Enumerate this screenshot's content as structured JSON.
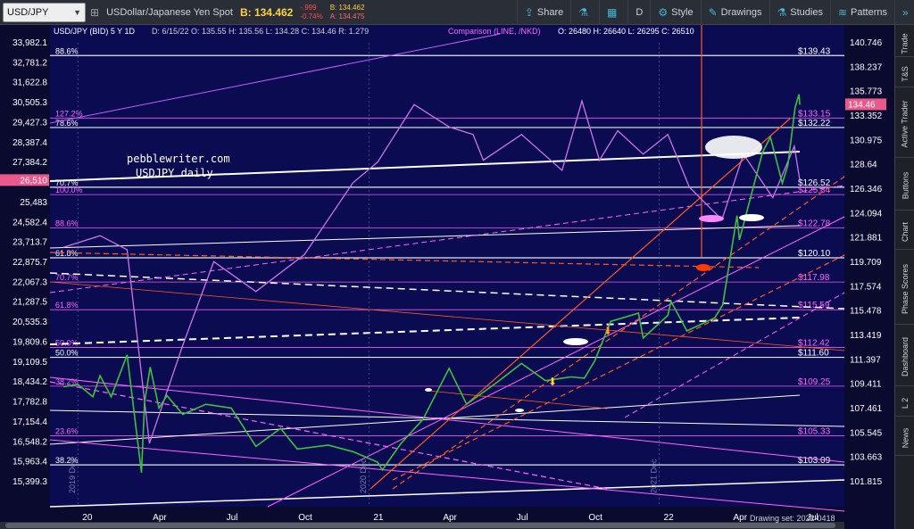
{
  "toolbar": {
    "symbol": "USD/JPY",
    "description": "USDollar/Japanese Yen Spot",
    "bid_label": "B: 134.462",
    "change": "-.999",
    "change_pct": "-0.74%",
    "bid_small": "B: 134.462",
    "ask_small": "A: 134.475",
    "buttons": [
      {
        "label": "Share",
        "icon": "share-icon"
      },
      {
        "label": "",
        "icon": "flask-icon"
      },
      {
        "label": "",
        "icon": "calendar-icon"
      },
      {
        "label": "D",
        "icon": ""
      },
      {
        "label": "Style",
        "icon": "gear-icon"
      },
      {
        "label": "Drawings",
        "icon": "pencil-icon"
      },
      {
        "label": "Studies",
        "icon": "flask-icon"
      },
      {
        "label": "Patterns",
        "icon": "patterns-icon"
      }
    ]
  },
  "side_tabs": [
    "Trade",
    "T&S",
    "Active Trader",
    "Buttons",
    "Chart",
    "Phase Scores",
    "Dashboard",
    "L 2",
    "News"
  ],
  "chart_data": {
    "type": "line",
    "header": {
      "title": "USD/JPY (BID) 5 Y 1D",
      "fields": [
        "D: 6/15/22",
        "O: 135.55",
        "H: 135.56",
        "L: 134.28",
        "C: 134.46",
        "R: 1.279"
      ],
      "comparison": "Comparison (LINE, /NKD)",
      "comparison_fields": [
        "O: 26480",
        "H: 26640",
        "L: 26295",
        "C: 26510"
      ]
    },
    "annotation": [
      "pebblewriter.com",
      "USDJPY daily"
    ],
    "x_ticks": [
      "20",
      "Apr",
      "Jul",
      "Oct",
      "21",
      "Apr",
      "Jul",
      "Oct",
      "22",
      "Apr",
      "Jul"
    ],
    "x_tick_years": [
      "2019 Dec",
      "2020 Dec",
      "2021 Dec"
    ],
    "right_axis": {
      "ticks": [
        140.746,
        138.237,
        135.773,
        133.352,
        130.975,
        128.64,
        126.346,
        124.094,
        121.881,
        119.709,
        117.574,
        115.478,
        113.419,
        111.397,
        109.411,
        107.461,
        105.545,
        103.663,
        101.815
      ],
      "labels": [
        "140.746",
        "138.237",
        "135.773",
        "133.352",
        "130.975",
        "128.64",
        "126.346",
        "124.094",
        "121.881",
        "119.709",
        "117.574",
        "115.478",
        "113.419",
        "111.397",
        "109.411",
        "107.461",
        "105.545",
        "103.663",
        "101.815"
      ],
      "current": "134.46"
    },
    "left_axis": {
      "ticks": [
        33982.1,
        32781.2,
        31622.8,
        30505.3,
        29427.3,
        28387.4,
        27384.2,
        25483,
        24582.4,
        23713.7,
        22875.7,
        22067.3,
        21287.5,
        20535.3,
        19809.6,
        19109.5,
        18434.2,
        17782.8,
        17154.4,
        16548.2,
        15963.4,
        15399.3
      ],
      "labels": [
        "33,982.1",
        "32,781.2",
        "31,622.8",
        "30,505.3",
        "29,427.3",
        "28,387.4",
        "27,384.2",
        "25,483",
        "24,582.4",
        "23,713.7",
        "22,875.7",
        "22,067.3",
        "21,287.5",
        "20,535.3",
        "19,809.6",
        "19,109.5",
        "18,434.2",
        "17,782.8",
        "17,154.4",
        "16,548.2",
        "15,963.4",
        "15,399.3"
      ],
      "current": "26,510"
    },
    "levels": [
      {
        "value": 139.43,
        "label": "$139.43",
        "color": "#ffffff",
        "pct": "88.6%",
        "pct_color": "#ffffff"
      },
      {
        "value": 133.15,
        "label": "$133.15",
        "color": "#ff66ff",
        "pct": "127.2%",
        "pct_color": "#ff66ff"
      },
      {
        "value": 132.22,
        "label": "$132.22",
        "color": "#ffffff",
        "pct": "78.6%",
        "pct_color": "#ffffff"
      },
      {
        "value": 126.52,
        "label": "$126.52",
        "color": "#ffffff",
        "pct": "70.7%",
        "pct_color": "#ffffff"
      },
      {
        "value": 125.84,
        "label": "$125.84",
        "color": "#ff66ff",
        "pct": "100.0%",
        "pct_color": "#ff66ff"
      },
      {
        "value": 122.78,
        "label": "$122.78",
        "color": "#ff66ff",
        "pct": "88.6%",
        "pct_color": "#ff66ff"
      },
      {
        "value": 120.1,
        "label": "$120.10",
        "color": "#ffffff",
        "pct": "61.8%",
        "pct_color": "#ffffff"
      },
      {
        "value": 117.98,
        "label": "$117.98",
        "color": "#ff66ff",
        "pct": "70.7%",
        "pct_color": "#ff66ff"
      },
      {
        "value": 115.59,
        "label": "$115.59",
        "color": "#ff66ff",
        "pct": "61.8%",
        "pct_color": "#ff66ff"
      },
      {
        "value": 112.42,
        "label": "$112.42",
        "color": "#ff66ff",
        "pct": "50.0%",
        "pct_color": "#ff66ff"
      },
      {
        "value": 111.6,
        "label": "$111.60",
        "color": "#ffffff",
        "pct": "50.0%",
        "pct_color": "#ffffff"
      },
      {
        "value": 109.25,
        "label": "$109.25",
        "color": "#ff66ff",
        "pct": "38.2%",
        "pct_color": "#ff66ff"
      },
      {
        "value": 105.33,
        "label": "$105.33",
        "color": "#ff66ff",
        "pct": "23.6%",
        "pct_color": "#ff66ff"
      },
      {
        "value": 103.09,
        "label": "$103.09",
        "color": "#ffffff",
        "pct": "38.2%",
        "pct_color": "#ffffff"
      }
    ],
    "price_series": [
      [
        "2019-12-02",
        109.2
      ],
      [
        "2019-12-20",
        109.4
      ],
      [
        "2020-01-08",
        108.4
      ],
      [
        "2020-01-17",
        110.1
      ],
      [
        "2020-01-31",
        108.4
      ],
      [
        "2020-02-20",
        111.8
      ],
      [
        "2020-03-09",
        102.5
      ],
      [
        "2020-03-13",
        108.0
      ],
      [
        "2020-03-20",
        110.8
      ],
      [
        "2020-03-31",
        107.5
      ],
      [
        "2020-04-10",
        108.5
      ],
      [
        "2020-04-30",
        107.0
      ],
      [
        "2020-05-29",
        107.8
      ],
      [
        "2020-06-30",
        107.5
      ],
      [
        "2020-07-31",
        104.5
      ],
      [
        "2020-08-31",
        105.9
      ],
      [
        "2020-09-21",
        104.3
      ],
      [
        "2020-10-30",
        104.6
      ],
      [
        "2020-11-30",
        104.1
      ],
      [
        "2020-12-31",
        103.3
      ],
      [
        "2021-01-06",
        102.7
      ],
      [
        "2021-01-29",
        104.7
      ],
      [
        "2021-02-26",
        106.6
      ],
      [
        "2021-03-31",
        110.7
      ],
      [
        "2021-04-22",
        107.8
      ],
      [
        "2021-05-31",
        109.6
      ],
      [
        "2021-06-30",
        111.1
      ],
      [
        "2021-07-30",
        109.7
      ],
      [
        "2021-08-31",
        110.0
      ],
      [
        "2021-09-17",
        109.9
      ],
      [
        "2021-09-30",
        111.3
      ],
      [
        "2021-10-20",
        114.6
      ],
      [
        "2021-11-24",
        115.3
      ],
      [
        "2021-11-30",
        113.2
      ],
      [
        "2021-12-31",
        115.1
      ],
      [
        "2022-01-04",
        116.3
      ],
      [
        "2022-01-24",
        113.8
      ],
      [
        "2022-02-28",
        114.9
      ],
      [
        "2022-03-10",
        116.0
      ],
      [
        "2022-03-28",
        123.9
      ],
      [
        "2022-03-31",
        121.7
      ],
      [
        "2022-04-29",
        129.8
      ],
      [
        "2022-05-09",
        131.3
      ],
      [
        "2022-05-24",
        126.9
      ],
      [
        "2022-05-31",
        128.6
      ],
      [
        "2022-06-09",
        134.2
      ],
      [
        "2022-06-14",
        135.5
      ],
      [
        "2022-06-15",
        134.46
      ]
    ],
    "comparison_series": [
      [
        "2019-12-02",
        23500
      ],
      [
        "2020-01-17",
        24000
      ],
      [
        "2020-02-20",
        23400
      ],
      [
        "2020-03-19",
        16500
      ],
      [
        "2020-04-30",
        19700
      ],
      [
        "2020-06-08",
        22900
      ],
      [
        "2020-07-31",
        21700
      ],
      [
        "2020-09-30",
        23200
      ],
      [
        "2020-11-30",
        26400
      ],
      [
        "2020-12-31",
        27400
      ],
      [
        "2021-02-15",
        30400
      ],
      [
        "2021-03-31",
        29200
      ],
      [
        "2021-04-30",
        28800
      ],
      [
        "2021-05-13",
        27500
      ],
      [
        "2021-06-30",
        28800
      ],
      [
        "2021-08-20",
        27000
      ],
      [
        "2021-09-14",
        30600
      ],
      [
        "2021-10-06",
        27500
      ],
      [
        "2021-10-29",
        29000
      ],
      [
        "2021-11-30",
        27800
      ],
      [
        "2021-12-31",
        28800
      ],
      [
        "2022-01-27",
        26200
      ],
      [
        "2022-03-09",
        24700
      ],
      [
        "2022-04-05",
        27800
      ],
      [
        "2022-05-12",
        25700
      ],
      [
        "2022-06-08",
        28200
      ],
      [
        "2022-06-15",
        26510
      ]
    ]
  },
  "status": "Drawing set: 2022-0418"
}
